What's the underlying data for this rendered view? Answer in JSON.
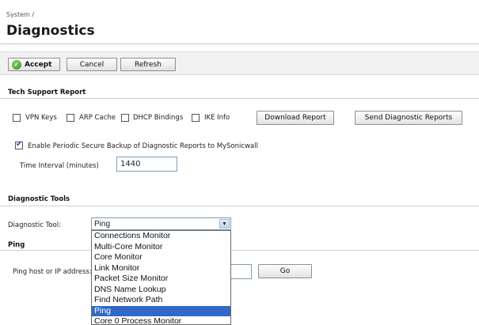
{
  "header": {
    "breadcrumb": "System /",
    "title": "Diagnostics"
  },
  "toolbar": {
    "accept_label": "Accept",
    "cancel_label": "Cancel",
    "refresh_label": "Refresh"
  },
  "tech_support": {
    "section_title": "Tech Support Report",
    "checkboxes": [
      {
        "label": "VPN Keys",
        "checked": false
      },
      {
        "label": "ARP Cache",
        "checked": false
      },
      {
        "label": "DHCP Bindings",
        "checked": false
      },
      {
        "label": "IKE Info",
        "checked": false
      }
    ],
    "download_label": "Download Report",
    "send_label": "Send Diagnostic Reports",
    "periodic_backup": {
      "label": "Enable Periodic Secure Backup of Diagnostic Reports to MySonicwall",
      "checked": true
    },
    "interval_label": "Time Interval (minutes)",
    "interval_value": "1440"
  },
  "diagnostic_tools": {
    "section_title": "Diagnostic Tools",
    "tool_label": "Diagnostic Tool:",
    "selected_tool": "Ping",
    "options": [
      "Connections Monitor",
      "Multi-Core Monitor",
      "Core Monitor",
      "Link Monitor",
      "Packet Size Monitor",
      "DNS Name Lookup",
      "Find Network Path",
      "Ping",
      "Core 0 Process Monitor"
    ],
    "highlighted_option": "Ping"
  },
  "ping": {
    "section_title": "Ping",
    "host_label": "Ping host or IP address:",
    "host_value": "",
    "go_label": "Go"
  }
}
